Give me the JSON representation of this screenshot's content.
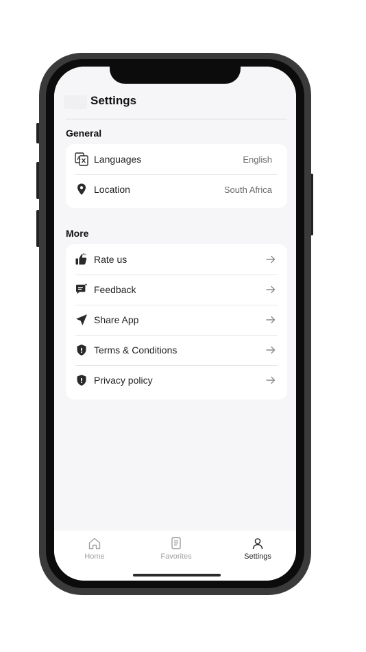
{
  "header": {
    "title": "Settings"
  },
  "sections": [
    {
      "title": "General",
      "items": [
        {
          "label": "Languages",
          "value": "English",
          "icon": "translate-icon"
        },
        {
          "label": "Location",
          "value": "South Africa",
          "icon": "location-pin-icon"
        }
      ]
    },
    {
      "title": "More",
      "items": [
        {
          "label": "Rate us",
          "icon": "thumbs-up-icon"
        },
        {
          "label": "Feedback",
          "icon": "feedback-icon"
        },
        {
          "label": "Share App",
          "icon": "send-icon"
        },
        {
          "label": "Terms & Conditions",
          "icon": "shield-icon"
        },
        {
          "label": "Privacy policy",
          "icon": "shield-icon"
        }
      ]
    }
  ],
  "tabbar": {
    "items": [
      {
        "label": "Home",
        "icon": "home-icon",
        "active": false
      },
      {
        "label": "Favorites",
        "icon": "book-icon",
        "active": false
      },
      {
        "label": "Settings",
        "icon": "user-icon",
        "active": true
      }
    ]
  },
  "colors": {
    "accent": "#1f1f1f",
    "muted": "#a0a0a0",
    "background": "#f6f6f8"
  }
}
